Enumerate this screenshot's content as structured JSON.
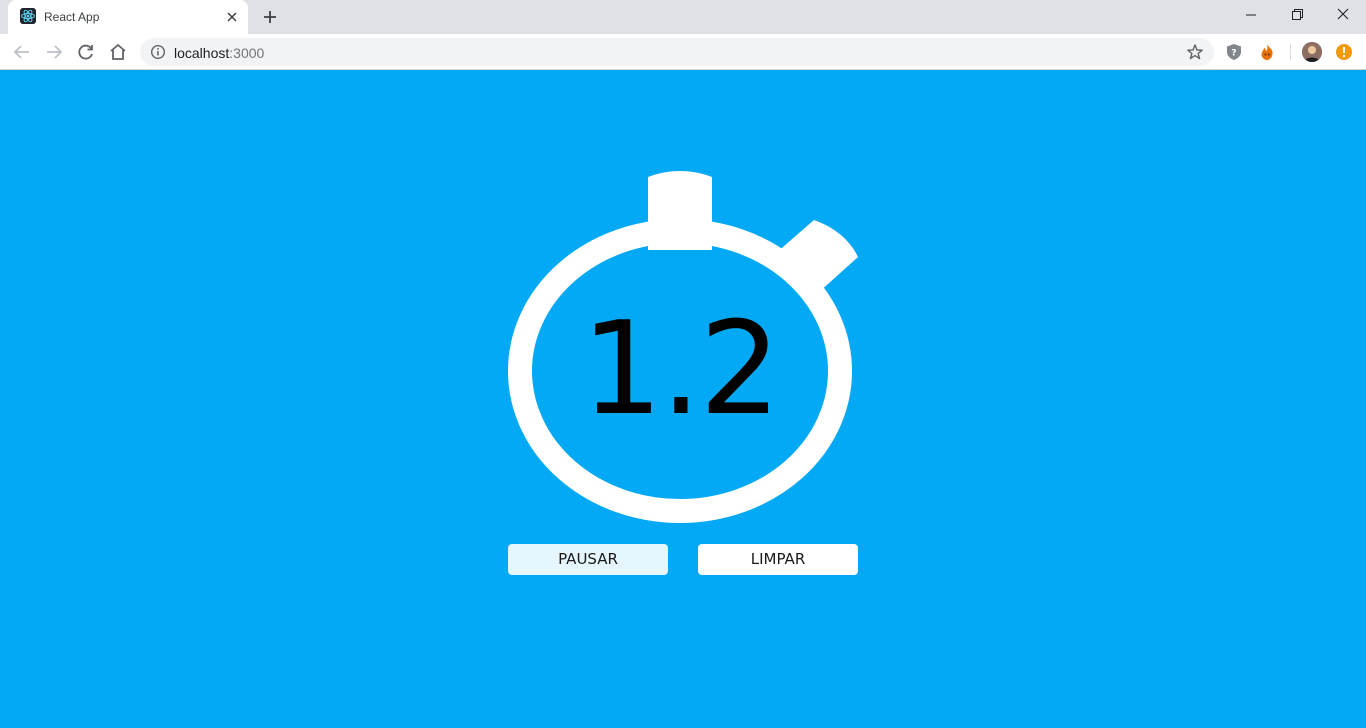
{
  "browser": {
    "tab_title": "React App",
    "url_host": "localhost",
    "url_port": ":3000",
    "icons": {
      "favicon": "react-logo-icon",
      "tab_close": "close-icon",
      "new_tab": "plus-icon",
      "back": "arrow-left-icon",
      "forward": "arrow-right-icon",
      "reload": "reload-icon",
      "home": "home-icon",
      "site_info": "info-icon",
      "bookmark": "star-icon",
      "extension_1": "shield-icon",
      "extension_2": "fire-icon",
      "profile": "avatar",
      "extension_3": "alert-icon"
    }
  },
  "app": {
    "background_color": "#03a9f4",
    "time": "1.2",
    "buttons": {
      "pause_label": "PAUSAR",
      "clear_label": "LIMPAR"
    }
  }
}
